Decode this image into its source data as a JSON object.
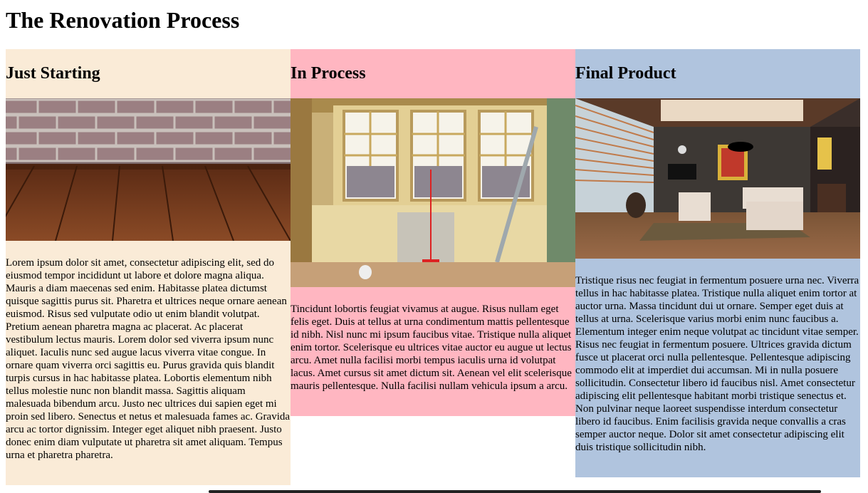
{
  "page": {
    "title": "The Renovation Process"
  },
  "columns": [
    {
      "heading": "Just Starting",
      "background": "#faebd7",
      "image": "brick-wall-wood-floor",
      "body": "Lorem ipsum dolor sit amet, consectetur adipiscing elit, sed do eiusmod tempor incididunt ut labore et dolore magna aliqua. Mauris a diam maecenas sed enim. Habitasse platea dictumst quisque sagittis purus sit. Pharetra et ultrices neque ornare aenean euismod. Risus sed vulputate odio ut enim blandit volutpat. Pretium aenean pharetra magna ac placerat. Ac placerat vestibulum lectus mauris. Lorem dolor sed viverra ipsum nunc aliquet. Iaculis nunc sed augue lacus viverra vitae congue. In ornare quam viverra orci sagittis eu. Purus gravida quis blandit turpis cursus in hac habitasse platea. Lobortis elementum nibh tellus molestie nunc non blandit massa. Sagittis aliquam malesuada bibendum arcu. Justo nec ultrices dui sapien eget mi proin sed libero. Senectus et netus et malesuada fames ac. Gravida arcu ac tortor dignissim. Integer eget aliquet nibh praesent. Justo donec enim diam vulputate ut pharetra sit amet aliquam. Tempus urna et pharetra pharetra."
    },
    {
      "heading": "In Process",
      "background": "#ffb6c1",
      "image": "room-under-construction",
      "body": "Tincidunt lobortis feugiat vivamus at augue. Risus nullam eget felis eget. Duis at tellus at urna condimentum mattis pellentesque id nibh. Nisl nunc mi ipsum faucibus vitae. Tristique nulla aliquet enim tortor. Scelerisque eu ultrices vitae auctor eu augue ut lectus arcu. Amet nulla facilisi morbi tempus iaculis urna id volutpat lacus. Amet cursus sit amet dictum sit. Aenean vel elit scelerisque mauris pellentesque. Nulla facilisi nullam vehicula ipsum a arcu."
    },
    {
      "heading": "Final Product",
      "background": "#b0c4de",
      "image": "finished-living-room",
      "body": "Tristique risus nec feugiat in fermentum posuere urna nec. Viverra tellus in hac habitasse platea. Tristique nulla aliquet enim tortor at auctor urna. Massa tincidunt dui ut ornare. Semper eget duis at tellus at urna. Scelerisque varius morbi enim nunc faucibus a. Elementum integer enim neque volutpat ac tincidunt vitae semper. Risus nec feugiat in fermentum posuere. Ultrices gravida dictum fusce ut placerat orci nulla pellentesque. Pellentesque adipiscing commodo elit at imperdiet dui accumsan. Mi in nulla posuere sollicitudin. Consectetur libero id faucibus nisl. Amet consectetur adipiscing elit pellentesque habitant morbi tristique senectus et. Non pulvinar neque laoreet suspendisse interdum consectetur libero id faucibus. Enim facilisis gravida neque convallis a cras semper auctor neque. Dolor sit amet consectetur adipiscing elit duis tristique sollicitudin nibh."
    }
  ]
}
